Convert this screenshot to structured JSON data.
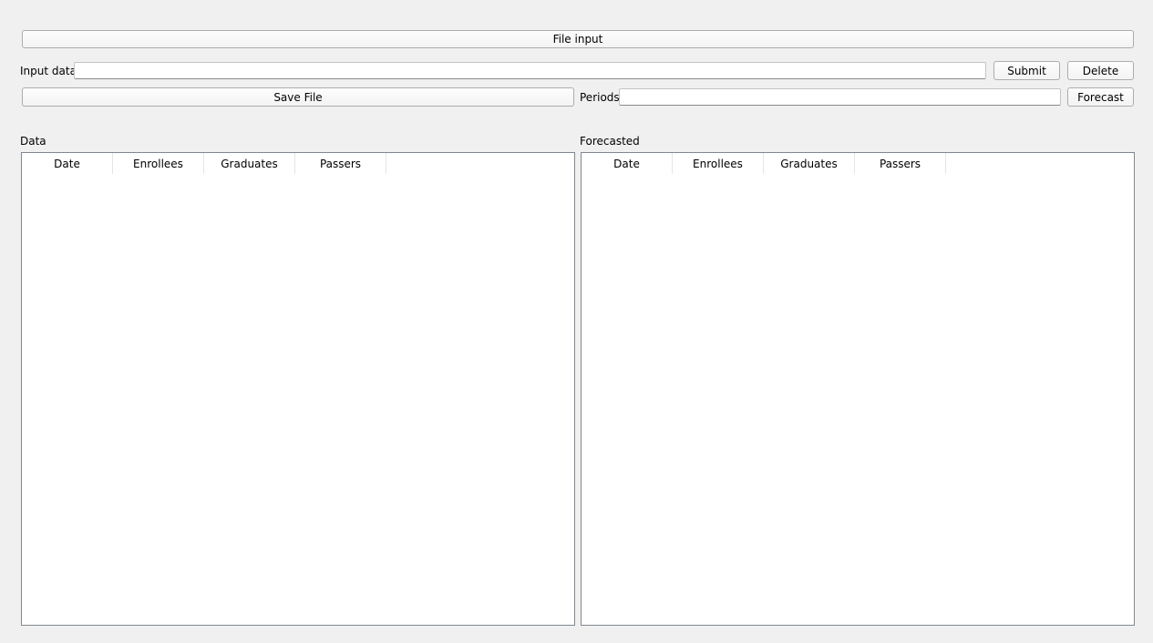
{
  "toolbar": {
    "file_input_label": "File input",
    "input_data_label": "Input data",
    "input_data_value": "",
    "submit_label": "Submit",
    "delete_label": "Delete",
    "save_file_label": "Save File",
    "periods_label": "Periods",
    "periods_value": "",
    "forecast_label": "Forecast"
  },
  "data_panel": {
    "title": "Data",
    "columns": [
      "Date",
      "Enrollees",
      "Graduates",
      "Passers"
    ],
    "rows": []
  },
  "forecast_panel": {
    "title": "Forecasted",
    "columns": [
      "Date",
      "Enrollees",
      "Graduates",
      "Passers"
    ],
    "rows": []
  }
}
